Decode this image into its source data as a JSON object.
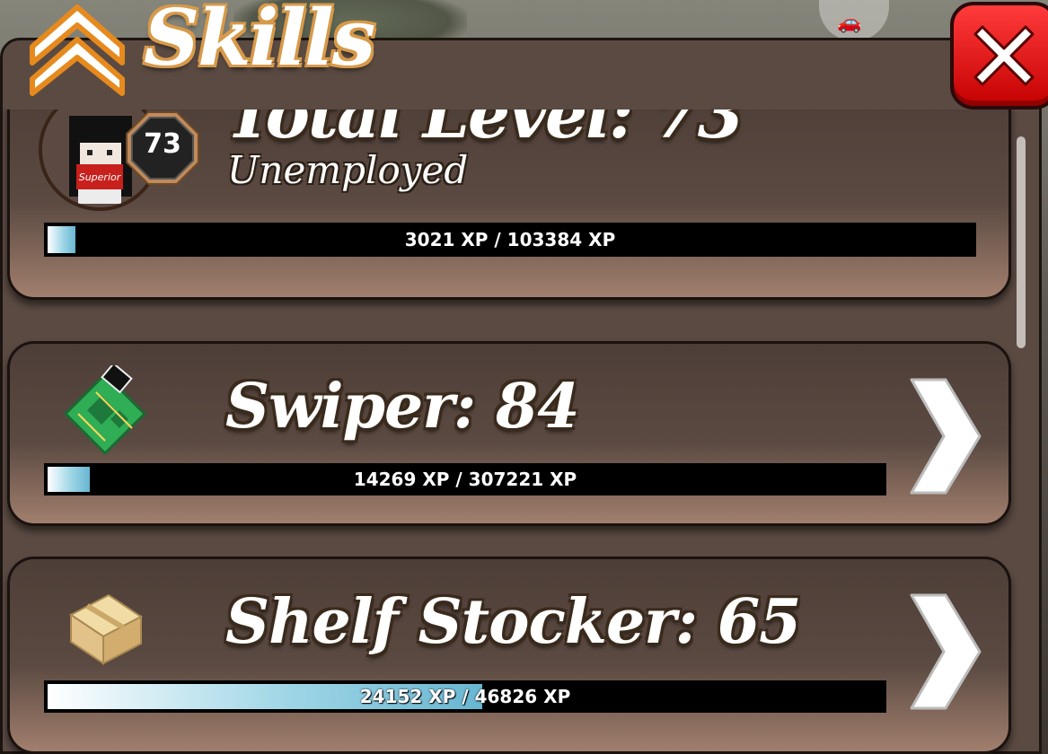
{
  "header": {
    "title": "Skills"
  },
  "total": {
    "title": "Total Level: 73",
    "job": "Unemployed",
    "level_badge": "73",
    "xp_text": "3021 XP / 103384 XP",
    "progress": 0.03
  },
  "skills": [
    {
      "title": "Swiper: 84",
      "xp_text": "14269 XP / 307221 XP",
      "progress": 0.05,
      "icon": "circuit-board-icon"
    },
    {
      "title": "Shelf Stocker: 65",
      "xp_text": "24152 XP / 46826 XP",
      "progress": 0.52,
      "icon": "cardboard-box-icon"
    }
  ],
  "colors": {
    "accent_orange": "#d79a4a",
    "close_red": "#e21b1b",
    "xp_fill": "#68b6d2"
  }
}
